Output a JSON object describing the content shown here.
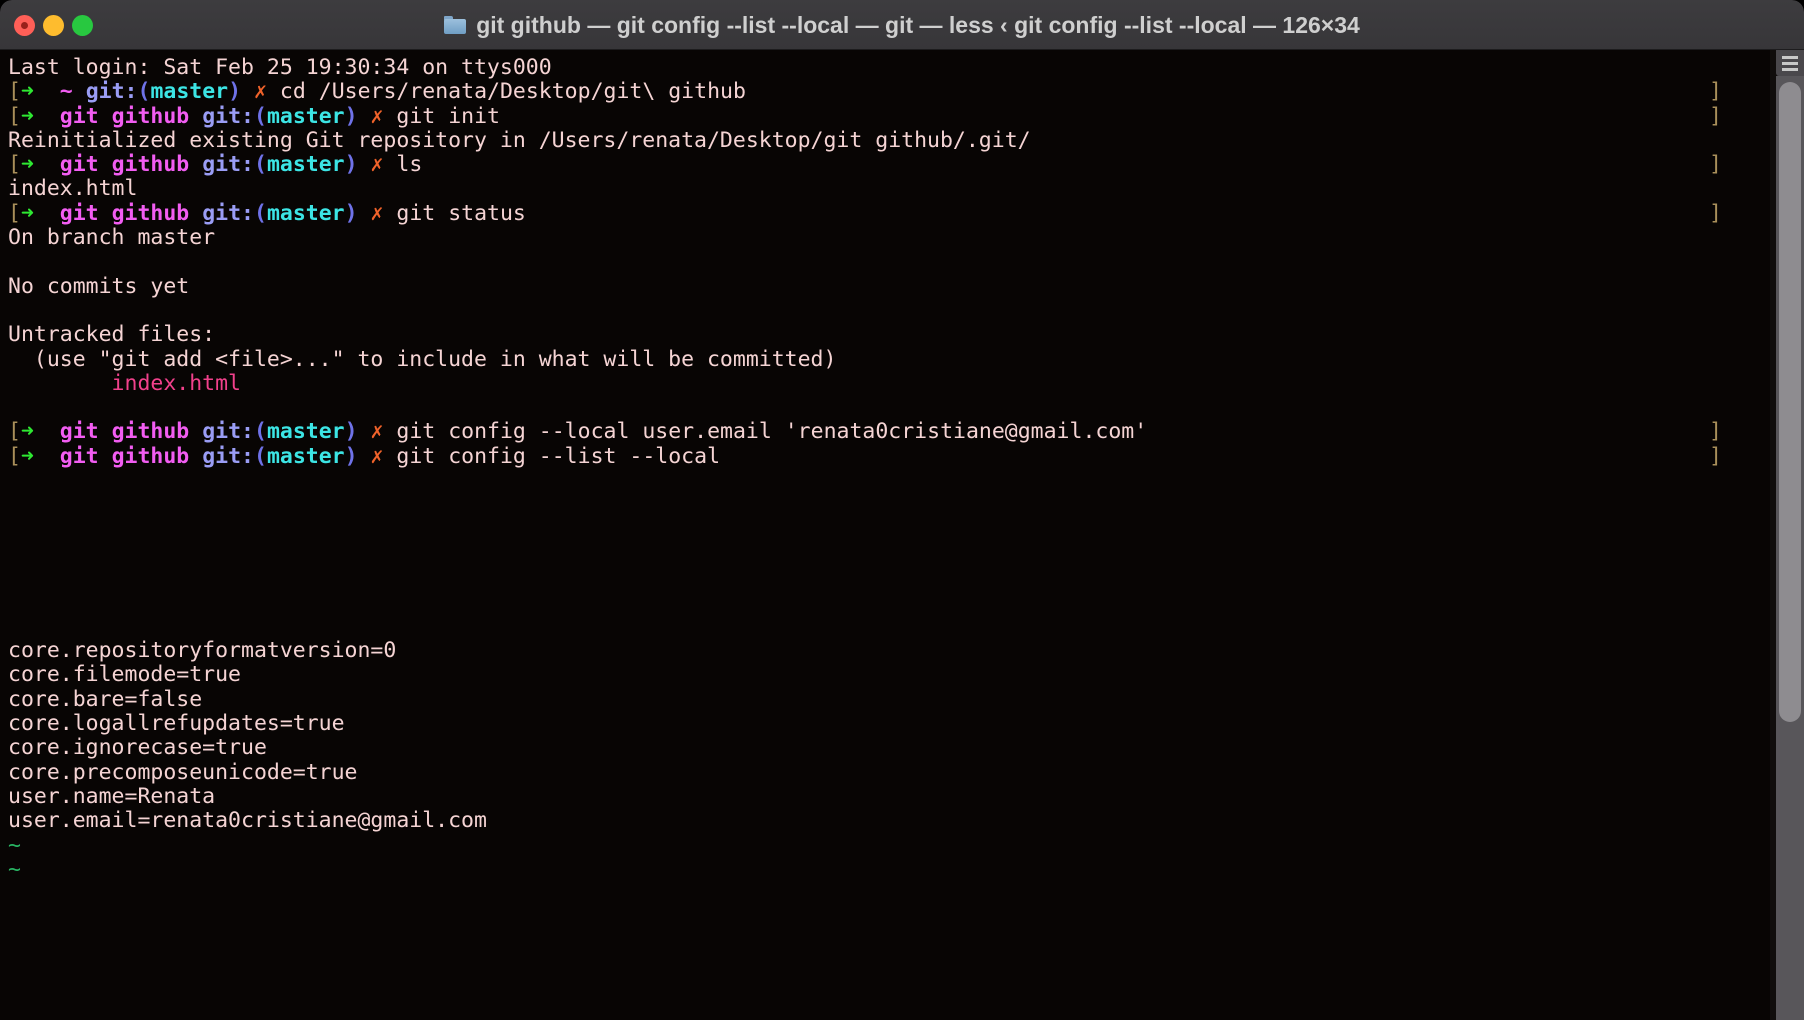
{
  "window": {
    "title": "git github — git config --list --local — git — less ‹ git config --list --local — 126×34",
    "folder_icon": "folder-icon",
    "traffic_lights": {
      "close": "close-button",
      "minimize": "minimize-button",
      "maximize": "maximize-button"
    }
  },
  "colors": {
    "background": "#080504",
    "titlebar": "#3b3a3d",
    "foreground": "#f5d4d4",
    "prompt_bracket": "#a98f5a",
    "prompt_arrow": "#2ee832",
    "prompt_path": "#f25df2",
    "prompt_git": "#9a9df5",
    "prompt_branch": "#3ce5e5",
    "prompt_mark": "#f0622a",
    "untracked_file": "#f2418c",
    "tilde": "#28b463",
    "traffic_close": "#ff5f57",
    "traffic_min": "#febc2e",
    "traffic_max": "#28c840"
  },
  "terminal": {
    "rows": [
      {
        "kind": "output",
        "text": "Last login: Sat Feb 25 19:30:34 on ttys000",
        "end": ""
      },
      {
        "kind": "prompt",
        "cwd": "~",
        "branch": "master",
        "command": "cd /Users/renata/Desktop/git\\ github",
        "end": "]"
      },
      {
        "kind": "prompt",
        "cwd": "git github",
        "branch": "master",
        "command": "git init",
        "end": "]"
      },
      {
        "kind": "output",
        "text": "Reinitialized existing Git repository in /Users/renata/Desktop/git github/.git/",
        "end": ""
      },
      {
        "kind": "prompt",
        "cwd": "git github",
        "branch": "master",
        "command": "ls",
        "end": "]"
      },
      {
        "kind": "output",
        "text": "index.html",
        "end": ""
      },
      {
        "kind": "prompt",
        "cwd": "git github",
        "branch": "master",
        "command": "git status",
        "end": "]"
      },
      {
        "kind": "output",
        "text": "On branch master",
        "end": ""
      },
      {
        "kind": "output",
        "text": "",
        "end": ""
      },
      {
        "kind": "output",
        "text": "No commits yet",
        "end": ""
      },
      {
        "kind": "output",
        "text": "",
        "end": ""
      },
      {
        "kind": "output",
        "text": "Untracked files:",
        "end": ""
      },
      {
        "kind": "output",
        "text": "  (use \"git add <file>...\" to include in what will be committed)",
        "end": ""
      },
      {
        "kind": "file",
        "text": "        index.html",
        "end": ""
      },
      {
        "kind": "output",
        "text": "",
        "end": ""
      },
      {
        "kind": "prompt",
        "cwd": "git github",
        "branch": "master",
        "command": "git config --local user.email 'renata0cristiane@gmail.com'",
        "end": "]"
      },
      {
        "kind": "prompt",
        "cwd": "git github",
        "branch": "master",
        "command": "git config --list --local",
        "end": "]"
      },
      {
        "kind": "output",
        "text": "",
        "end": ""
      },
      {
        "kind": "output",
        "text": "",
        "end": ""
      },
      {
        "kind": "output",
        "text": "",
        "end": ""
      },
      {
        "kind": "output",
        "text": "",
        "end": ""
      },
      {
        "kind": "output",
        "text": "",
        "end": ""
      },
      {
        "kind": "output",
        "text": "",
        "end": ""
      },
      {
        "kind": "output",
        "text": "",
        "end": ""
      },
      {
        "kind": "output",
        "text": "core.repositoryformatversion=0",
        "end": ""
      },
      {
        "kind": "output",
        "text": "core.filemode=true",
        "end": ""
      },
      {
        "kind": "output",
        "text": "core.bare=false",
        "end": ""
      },
      {
        "kind": "output",
        "text": "core.logallrefupdates=true",
        "end": ""
      },
      {
        "kind": "output",
        "text": "core.ignorecase=true",
        "end": ""
      },
      {
        "kind": "output",
        "text": "core.precomposeunicode=true",
        "end": ""
      },
      {
        "kind": "output",
        "text": "user.name=Renata",
        "end": ""
      },
      {
        "kind": "output",
        "text": "user.email=renata0cristiane@gmail.com",
        "end": ""
      },
      {
        "kind": "tilde",
        "text": "~",
        "end": ""
      },
      {
        "kind": "tilde",
        "text": "~",
        "end": ""
      }
    ],
    "prompt_glyphs": {
      "open_bracket": "[",
      "arrow": "➜",
      "git_label": "git:",
      "open_paren": "(",
      "close_paren": ")",
      "dirty_mark": "✗",
      "close_bracket": "]"
    }
  },
  "scrollbar": {
    "menu_icon": "hamburger-icon"
  }
}
